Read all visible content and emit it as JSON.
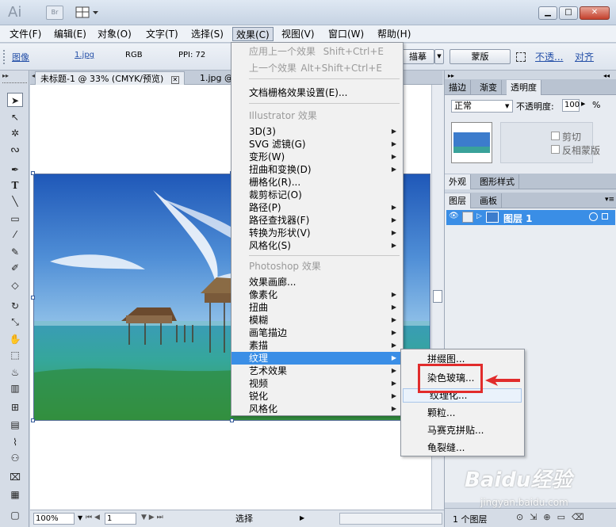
{
  "app": {
    "logo": "Ai",
    "bridge": "Br"
  },
  "window_buttons": {
    "minimize": "▁",
    "maximize": "□",
    "close": "✕"
  },
  "menubar": [
    "文件(F)",
    "编辑(E)",
    "对象(O)",
    "文字(T)",
    "选择(S)",
    "效果(C)",
    "视图(V)",
    "窗口(W)",
    "帮助(H)"
  ],
  "controlbar": {
    "image": "图像",
    "file": "1.jpg",
    "mode": "RGB",
    "ppi": "PPI: 72",
    "trace": "描摹",
    "mask": "蒙版",
    "opacity_link": "不透...",
    "align": "对齐"
  },
  "doc_tabs": {
    "active": "未标题-1 @ 33% (CMYK/预览)",
    "other": "1.jpg @"
  },
  "status": {
    "zoom": "100%",
    "page": "1",
    "mode": "选择"
  },
  "panels": {
    "top_tabs": [
      "描边",
      "渐变",
      "透明度"
    ],
    "blend_mode": "正常",
    "opacity_label": "不透明度:",
    "opacity_value": "100",
    "opacity_unit": "%",
    "clip": "剪切",
    "invert": "反相蒙版",
    "mid_tabs": [
      "外观",
      "图形样式"
    ],
    "layer_tabs": [
      "图层",
      "画板"
    ],
    "layer_name": "图层 1",
    "layer_count": "1 个图层"
  },
  "effect_menu": {
    "apply_last": "应用上一个效果",
    "apply_last_sc": "Shift+Ctrl+E",
    "last_effect": "上一个效果",
    "last_effect_sc": "Alt+Shift+Ctrl+E",
    "doc_raster": "文档栅格效果设置(E)...",
    "illustrator_header": "Illustrator 效果",
    "illustrator_items": [
      "3D(3)",
      "SVG 滤镜(G)",
      "变形(W)",
      "扭曲和变换(D)",
      "栅格化(R)...",
      "裁剪标记(O)",
      "路径(P)",
      "路径查找器(F)",
      "转换为形状(V)",
      "风格化(S)"
    ],
    "photoshop_header": "Photoshop 效果",
    "photoshop_items": [
      "效果画廊...",
      "像素化",
      "扭曲",
      "模糊",
      "画笔描边",
      "素描",
      "纹理",
      "艺术效果",
      "视频",
      "锐化",
      "风格化"
    ]
  },
  "texture_menu": [
    "拼缀图...",
    "染色玻璃...",
    "纹理化...",
    "颗粒...",
    "马赛克拼贴...",
    "龟裂缝..."
  ],
  "watermark": {
    "text": "Baidu经验",
    "sub": "jingyan.baidu.com"
  }
}
